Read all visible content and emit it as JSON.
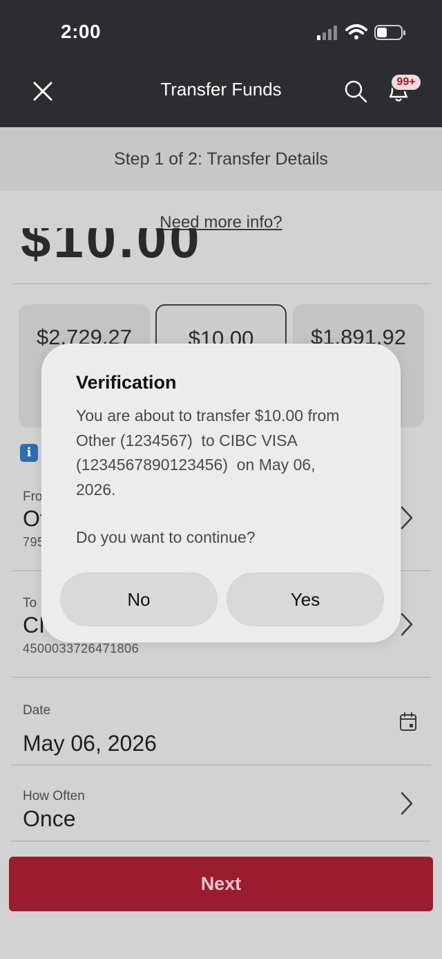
{
  "status_bar": {
    "time": "2:00"
  },
  "nav": {
    "title": "Transfer Funds",
    "notification_badge": "99+"
  },
  "step": {
    "text": "Step 1 of 2: Transfer Details"
  },
  "help_link": "Need more info?",
  "amount_partial": "$10.00",
  "amount_cards": [
    {
      "value": "$2,729.27"
    },
    {
      "value": "$10.00"
    },
    {
      "value": "$1,891.92"
    }
  ],
  "from": {
    "label": "Fro",
    "value": "Ot",
    "sub": "795"
  },
  "to": {
    "label": "To",
    "value": "CI",
    "sub": "4500033726471806"
  },
  "date": {
    "label": "Date",
    "value": "May 06, 2026"
  },
  "how_often": {
    "label": "How Often",
    "value": "Once"
  },
  "next_button": "Next",
  "modal": {
    "title": "Verification",
    "body_line1": "You are about to transfer $10.00 from",
    "body_line2": "Other (1234567)  to CIBC VISA",
    "body_line3": "(1234567890123456)  on May 06,",
    "body_line4": "2026.",
    "question": "Do you want to continue?",
    "no_label": "No",
    "yes_label": "Yes"
  },
  "colors": {
    "header_bg": "#2b2d31",
    "next_button": "#9b1c2f",
    "info_icon": "#2f6cb0"
  }
}
